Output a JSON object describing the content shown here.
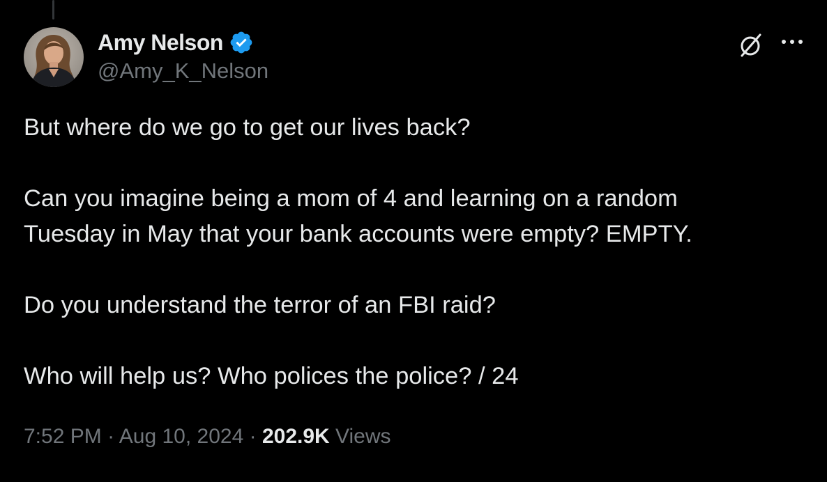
{
  "author": {
    "display_name": "Amy Nelson",
    "handle": "@Amy_K_Nelson",
    "verified": true
  },
  "icons": {
    "verified": "verified-badge-icon",
    "grok": "grok-icon",
    "more": "more-options-icon",
    "avatar": "avatar"
  },
  "tweet": {
    "lines": [
      "But where do we go to get our lives back?",
      "Can you imagine being a mom of 4 and learning on a random",
      "Tuesday in May that your bank accounts were empty? EMPTY.",
      "Do you understand the terror of an FBI raid?",
      "Who will help us? Who polices the police? / 24"
    ]
  },
  "meta": {
    "time": "7:52 PM",
    "separator": "·",
    "date": "Aug 10, 2024",
    "views_count": "202.9K",
    "views_label": "Views"
  },
  "colors": {
    "background": "#000000",
    "primary_text": "#e7e9ea",
    "secondary_text": "#71767b",
    "verified_blue": "#1d9bf0"
  }
}
